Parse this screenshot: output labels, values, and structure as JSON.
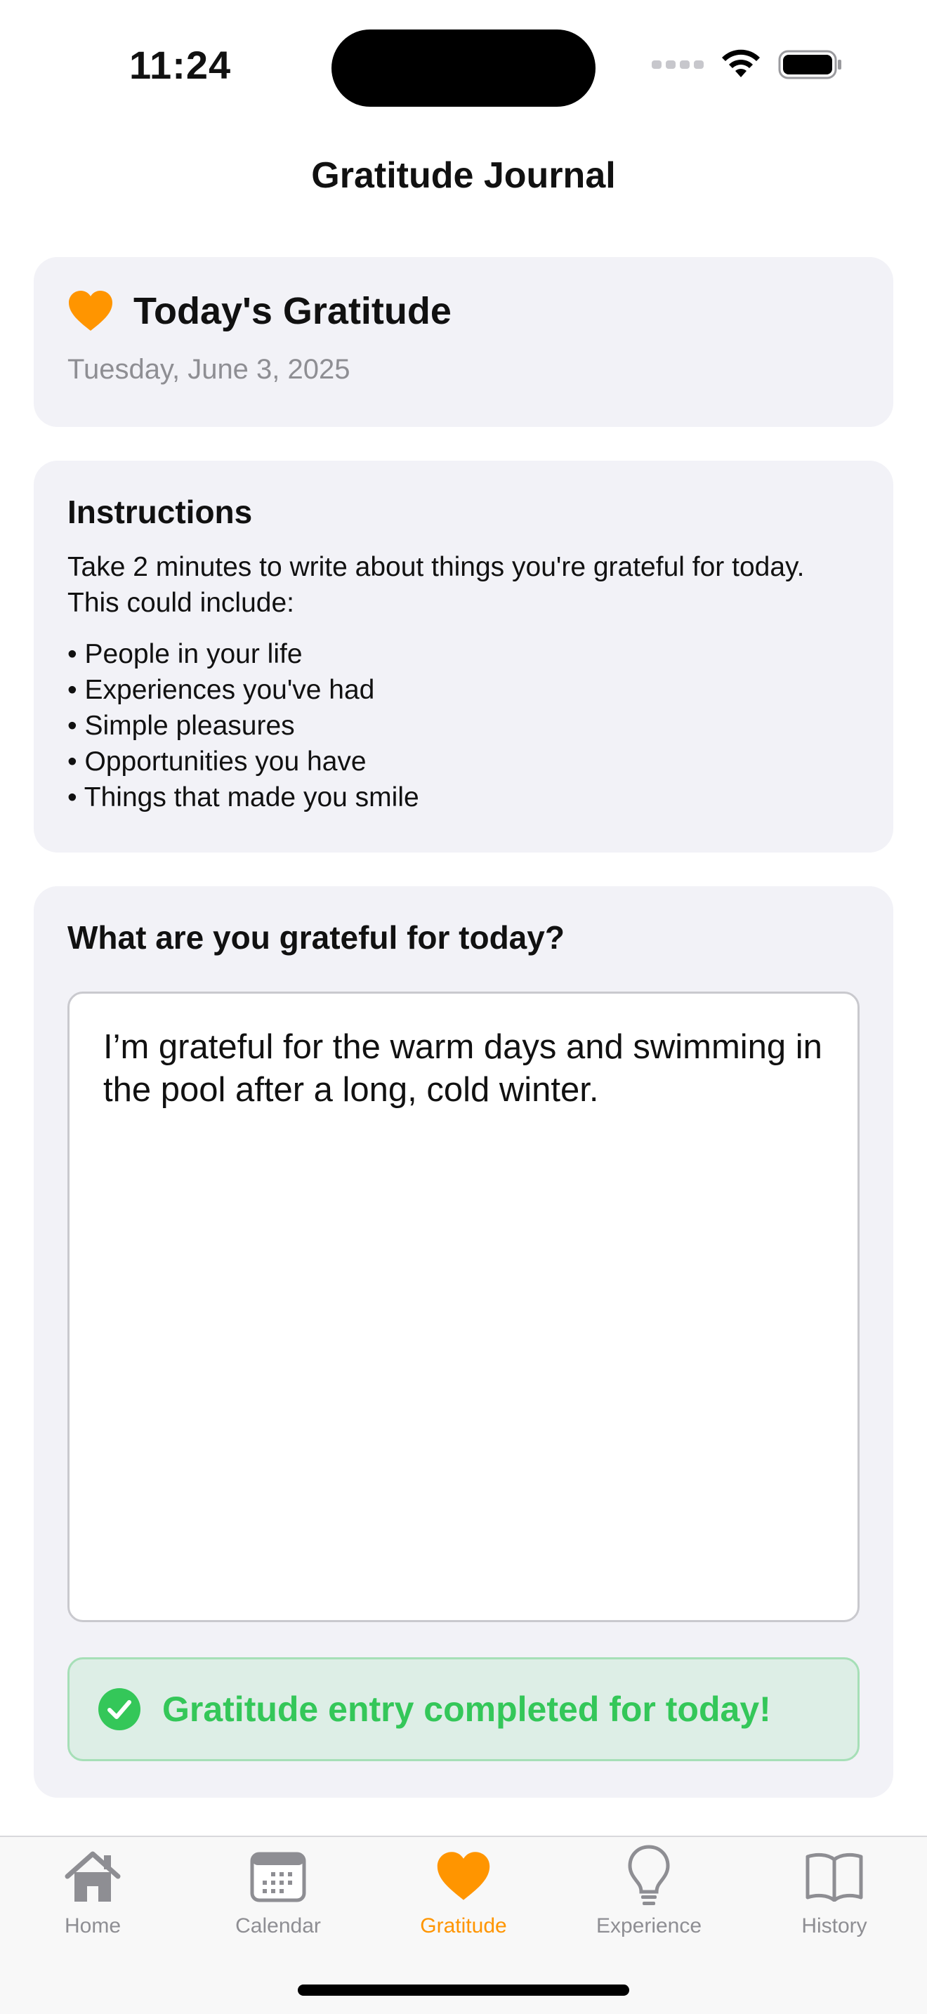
{
  "status_bar": {
    "time": "11:24"
  },
  "nav": {
    "title": "Gratitude Journal"
  },
  "today_card": {
    "icon": "heart-icon",
    "title": "Today's Gratitude",
    "date": "Tuesday, June 3, 2025"
  },
  "instructions": {
    "title": "Instructions",
    "text": "Take 2 minutes to write about things you're grateful for today. This could include:",
    "items": [
      "• People in your life",
      "• Experiences you've had",
      "• Simple pleasures",
      "• Opportunities you have",
      "• Things that made you smile"
    ]
  },
  "entry": {
    "question": "What are you grateful for today?",
    "text": "I’m grateful for the warm days and swimming in the pool after a long, cold winter.",
    "success_message": "Gratitude entry completed for today!"
  },
  "tabs": [
    {
      "label": "Home",
      "icon": "house-icon",
      "active": false
    },
    {
      "label": "Calendar",
      "icon": "calendar-icon",
      "active": false
    },
    {
      "label": "Gratitude",
      "icon": "heart-icon",
      "active": true
    },
    {
      "label": "Experience",
      "icon": "lightbulb-icon",
      "active": false
    },
    {
      "label": "History",
      "icon": "book-icon",
      "active": false
    }
  ],
  "colors": {
    "accent": "#ff9500",
    "success": "#34c759",
    "card_background": "#f2f2f7",
    "secondary_text": "#8e8e93"
  }
}
